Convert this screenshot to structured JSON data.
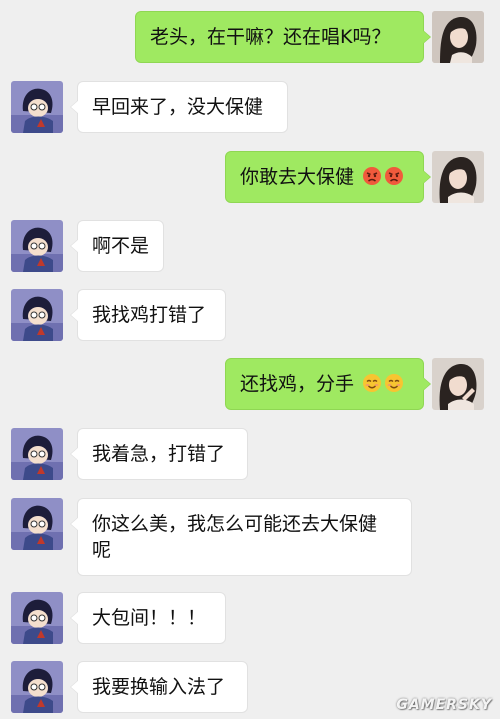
{
  "colors": {
    "background": "#efefef",
    "sent_bubble": "#9fe961",
    "received_bubble": "#ffffff"
  },
  "messages": [
    {
      "sender": "me",
      "text": "老头，在干嘛？还在唱K吗？"
    },
    {
      "sender": "other",
      "text": "早回来了，没大保健"
    },
    {
      "sender": "me",
      "text": "你敢去大保健",
      "emojis": [
        "angry-face-icon",
        "angry-face-icon"
      ]
    },
    {
      "sender": "other",
      "text": "啊不是"
    },
    {
      "sender": "other",
      "text": "我找鸡打错了"
    },
    {
      "sender": "me",
      "text": "还找鸡，分手",
      "emojis": [
        "smiling-face-icon",
        "smiling-face-icon"
      ]
    },
    {
      "sender": "other",
      "text": "我着急，打错了"
    },
    {
      "sender": "other",
      "text": "你这么美，我怎么可能还去大保健",
      "text_line2": "呢"
    },
    {
      "sender": "other",
      "text": "大包间！！！"
    },
    {
      "sender": "other",
      "text": "我要换输入法了"
    }
  ],
  "watermark": "GAMERSKY"
}
